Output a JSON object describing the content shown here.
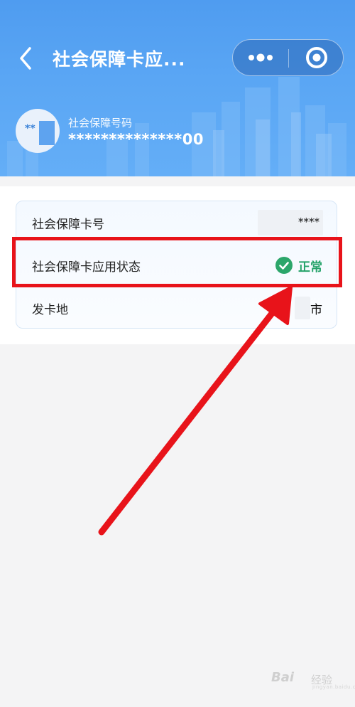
{
  "nav": {
    "title": "社会保障卡应..."
  },
  "header": {
    "ss_label": "社会保障号码",
    "ss_number": "**************00",
    "avatar_text": "**"
  },
  "card": {
    "rows": [
      {
        "label": "社会保障卡号",
        "value": "****"
      },
      {
        "label": "社会保障卡应用状态",
        "value": "正常",
        "status_color": "#26a36a"
      },
      {
        "label": "发卡地",
        "value": "市"
      }
    ]
  },
  "colors": {
    "header_blue": "#4f9cf0",
    "highlight_red": "#e8131a",
    "status_green": "#26a36a"
  },
  "icons": [
    "back-chevron-icon",
    "more-dots-icon",
    "close-target-icon",
    "check-circle-icon"
  ],
  "watermark": {
    "text": "Bai",
    "text2": "经验",
    "sub": "jingyan.baidu.com"
  }
}
